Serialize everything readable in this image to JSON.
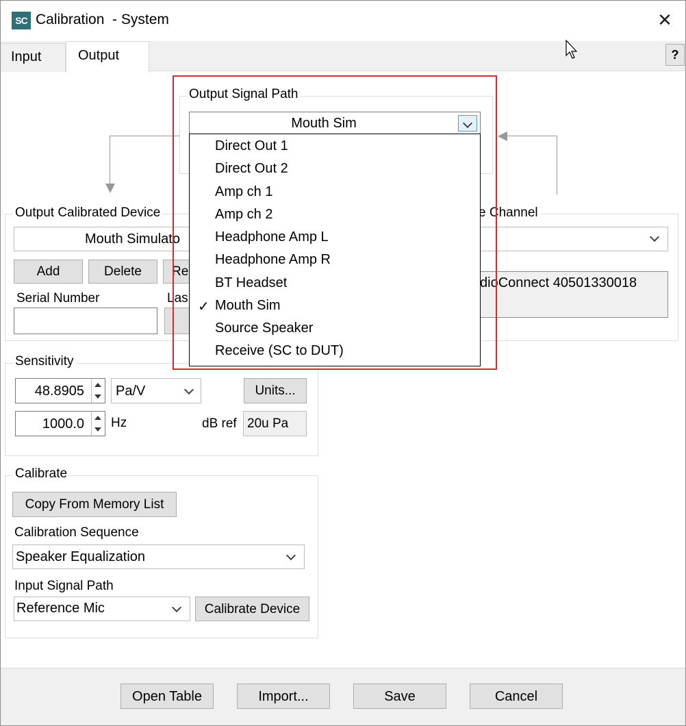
{
  "window": {
    "app_icon_text": "SC",
    "title": "Calibration  - System",
    "close_glyph": "✕"
  },
  "tabs": [
    {
      "label": "Input"
    },
    {
      "label": "Output"
    }
  ],
  "help_label": "?",
  "output_signal_path": {
    "label": "Output Signal Path",
    "selected": "Mouth Sim",
    "options": [
      "Direct Out 1",
      "Direct Out 2",
      "Amp ch 1",
      "Amp ch 2",
      "Headphone Amp L",
      "Headphone Amp R",
      "BT Headset",
      "Mouth Sim",
      "Source Speaker",
      "Receive (SC to DUT)"
    ],
    "checked_glyph": "✓"
  },
  "output_calibrated_device": {
    "label": "Output Calibrated Device",
    "value": "Mouth Simulato",
    "add_label": "Add",
    "delete_label": "Delete",
    "rename_label": "Re",
    "serial_number_label": "Serial Number",
    "serial_number_value": "",
    "last_label": "Las"
  },
  "channel": {
    "label": "e Channel",
    "device_text": "dioConnect 40501330018"
  },
  "sensitivity": {
    "label": "Sensitivity",
    "value": "48.8905",
    "unit": "Pa/V",
    "units_button": "Units...",
    "frequency": "1000.0",
    "frequency_unit": "Hz",
    "dbref_label": "dB ref",
    "dbref_value": "20u Pa"
  },
  "calibrate": {
    "label": "Calibrate",
    "copy_button": "Copy From Memory List",
    "sequence_label": "Calibration Sequence",
    "sequence_value": "Speaker Equalization",
    "input_path_label": "Input Signal Path",
    "input_path_value": "Reference Mic",
    "calibrate_device_button": "Calibrate Device"
  },
  "footer": {
    "open_table": "Open Table",
    "import": "Import...",
    "save": "Save",
    "cancel": "Cancel"
  }
}
